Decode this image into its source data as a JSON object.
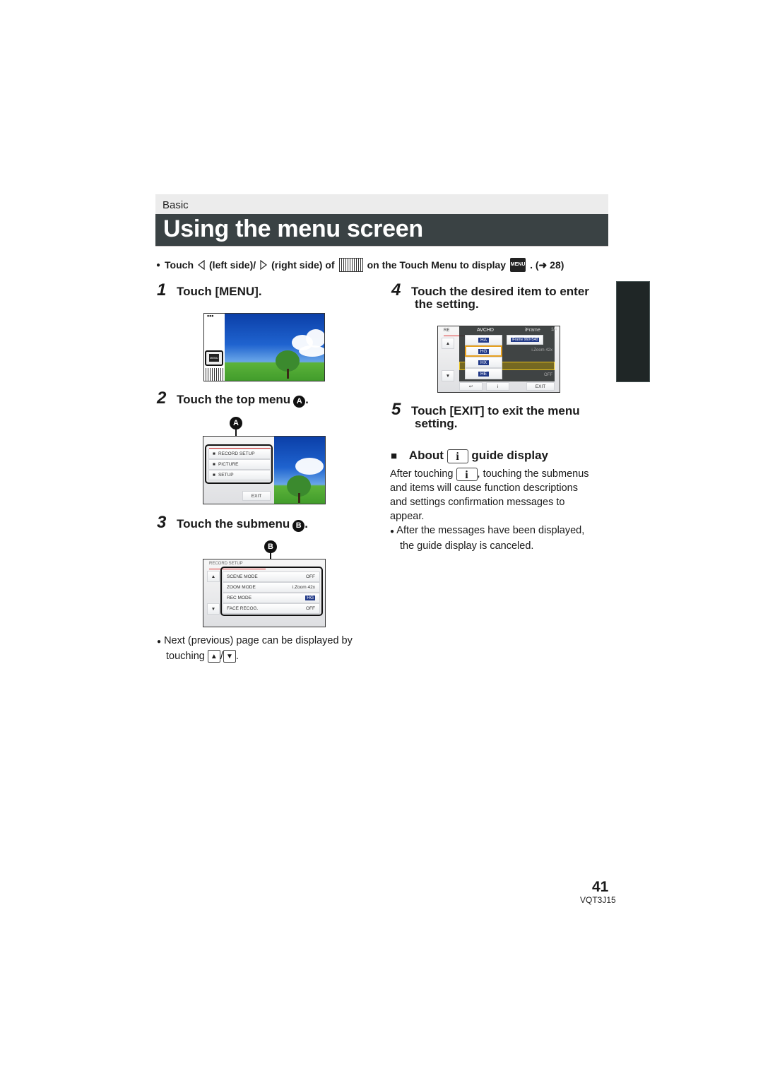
{
  "section": "Basic",
  "title": "Using the menu screen",
  "intro": {
    "bullet": "●",
    "touch": "Touch",
    "left": "(left side)/",
    "right": "(right side) of",
    "on_menu": "on the Touch Menu to display",
    "menu_icon": "MENU",
    "ref": ". (➜ 28)"
  },
  "steps": [
    {
      "num": "1",
      "text": "Touch [MENU]."
    },
    {
      "num": "2",
      "text": "Touch the top menu",
      "marker": "A"
    },
    {
      "num": "3",
      "text": "Touch the submenu",
      "marker": "B"
    },
    {
      "num": "4",
      "text": "Touch the desired item to enter",
      "text2": "the setting."
    },
    {
      "num": "5",
      "text": "Touch [EXIT] to exit the menu",
      "text2": "setting."
    }
  ],
  "screen1": {
    "dots": "•••",
    "menu_button": "MENU"
  },
  "screen2": {
    "items": [
      {
        "icon": "movie-camera-icon",
        "label": "RECORD SETUP"
      },
      {
        "icon": "camera-icon",
        "label": "PICTURE"
      },
      {
        "icon": "setup-icon",
        "label": "SETUP"
      }
    ],
    "exit": "EXIT",
    "callout": "A"
  },
  "screen3": {
    "header": "RECORD SETUP",
    "items": [
      {
        "label": "SCENE MODE",
        "value": "OFF"
      },
      {
        "label": "ZOOM MODE",
        "value": "i.Zoom 42x"
      },
      {
        "label": "REC MODE",
        "value": "HG"
      },
      {
        "label": "FACE RECOG.",
        "value": "OFF"
      }
    ],
    "callout": "B"
  },
  "screen4": {
    "header_left": "RE",
    "col1": "AVCHD",
    "col2": "iFrame",
    "page": "1/4",
    "options": [
      "HA",
      "HG",
      "HX",
      "HE"
    ],
    "iframe_option": "iFrame 960×540",
    "right_values": [
      "",
      "i.Zoom 42x",
      "HG",
      "OFF"
    ],
    "exit": "EXIT"
  },
  "next_note": {
    "bullet": "●",
    "line1": "Next (previous) page can be displayed by",
    "line2": "touching",
    "sep": "/",
    "end": "."
  },
  "about": {
    "square": "■",
    "title_pre": "About",
    "title_post": "guide display",
    "icon": "i",
    "p_start": "After touching",
    "p_rest": ", touching the submenus",
    "p_line2": "and items will cause function descriptions",
    "p_line3": "and settings confirmation messages to",
    "p_line4": "appear.",
    "bullet": "●",
    "b_line1": "After the messages have been displayed,",
    "b_line2": "the guide display is canceled."
  },
  "footer": {
    "page": "41",
    "code": "VQT3J15"
  }
}
